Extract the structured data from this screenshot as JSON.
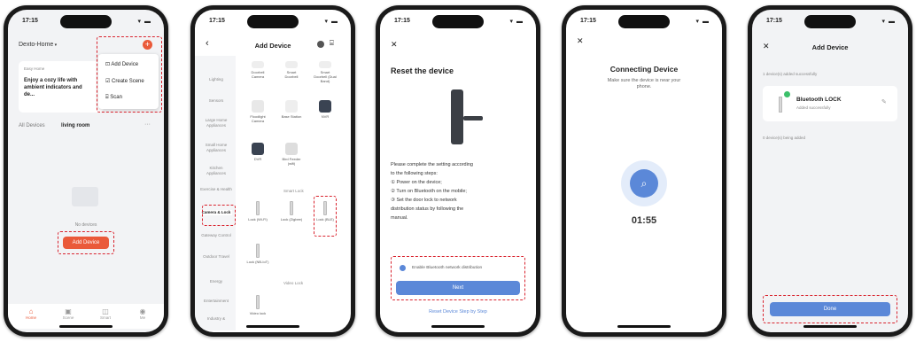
{
  "status": {
    "time": "17:15",
    "signal": "▾ ▬"
  },
  "phone1": {
    "home_name": "Dexto-Home",
    "card_tag": "Easy Home",
    "card_text": "Enjoy a cozy life with ambient indicators and de...",
    "menu": [
      "Add Device",
      "Create Scene",
      "Scan"
    ],
    "tabs": {
      "all": "All Devices",
      "room": "living room"
    },
    "more": "···",
    "empty_text": "No devices",
    "add_button": "Add Device",
    "nav": [
      "Home",
      "Scene",
      "Smart",
      "Me"
    ]
  },
  "phone2": {
    "title": "Add Device",
    "back": "‹",
    "categories": [
      "Lighting",
      "Sensors",
      "Large Home Appliances",
      "Small Home Appliances",
      "Kitchen Appliances",
      "Exercise & Health",
      "Camera & Lock",
      "Gateway Control",
      "Outdoor Travel",
      "Energy",
      "Entertainment",
      "Industry &"
    ],
    "devices_top": [
      "Doorbell Camera",
      "Smart Doorbell",
      "Smart Doorbell (Dual Band)"
    ],
    "devices_mid": [
      "Floodlight Camera",
      "Base Station",
      "NVR"
    ],
    "devices_mid2": [
      "DVR",
      "Bird Feeder (wifi)"
    ],
    "section_smart_lock": "Smart Lock",
    "locks": [
      "Lock (Wi-Fi)",
      "Lock (Zigbee)",
      "Lock (BLE)"
    ],
    "lock_wifi": "Lock (NB-IoT)",
    "section_video_lock": "Video Lock",
    "video_lock": "Video lock"
  },
  "phone3": {
    "close": "✕",
    "title": "Reset the device",
    "instructions": [
      "Please complete the setting according",
      "to the following steps:",
      "① Power on the device;",
      "② Turn on Bluetooth on the mobile;",
      "③ Set the door lock to network",
      "distribution status by following the",
      "manual."
    ],
    "checkbox_label": "Enable Bluetooth network distribution",
    "next": "Next",
    "link": "Reset Device Step by Step"
  },
  "phone4": {
    "close": "✕",
    "title": "Connecting Device",
    "subtitle": "Make sure the device is near your phone.",
    "timer": "01:55"
  },
  "phone5": {
    "close": "✕",
    "title": "Add Device",
    "added_text": "1 device(s) added successfully",
    "device_name": "Bluetooth LOCK",
    "device_status": "Added successfully",
    "pending_text": "0 device(s) being added",
    "done": "Done"
  },
  "colors": {
    "accent_red": "#ea5a3a",
    "accent_blue": "#5b88d8",
    "dash": "#d9232e"
  },
  "icons": [
    "plus-icon",
    "search-icon",
    "pencil-icon",
    "scan-icon",
    "settings-icon",
    "lock-icon"
  ]
}
